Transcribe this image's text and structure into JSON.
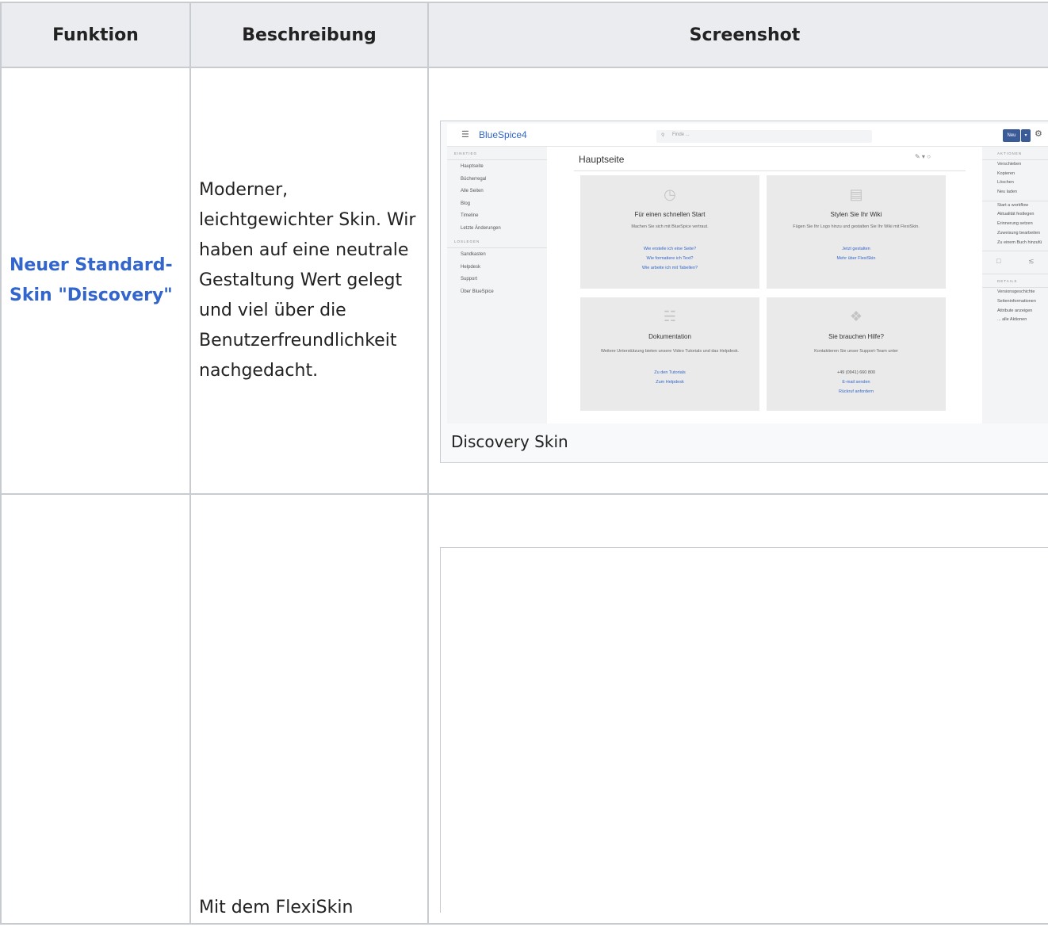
{
  "table": {
    "headers": [
      "Funktion",
      "Beschreibung",
      "Screenshot"
    ],
    "rows": [
      {
        "function": "Neuer Standard-Skin \"Discovery\"",
        "description": "Moderner, leichtgewichter Skin. Wir haben auf eine neutrale Gestaltung Wert gelegt und viel über die Benutzerfreundlichkeit nachgedacht.",
        "caption": "Discovery Skin"
      },
      {
        "function": "",
        "description": "Mit dem FlexiSkin"
      }
    ]
  },
  "shot": {
    "logo": "BlueSpice4",
    "search_placeholder": "Finde ...",
    "new_button": "Neu",
    "left_sidebar": {
      "section1": "EINSTIEG",
      "items1": [
        "Hauptseite",
        "Bücherregal",
        "Alle Seiten",
        "Blog",
        "Timeline",
        "Letzte Änderungen"
      ],
      "section2": "LOSLEGEN",
      "items2": [
        "Sandkasten",
        "Helpdesk",
        "Support",
        "Über BlueSpice"
      ]
    },
    "page_title": "Hauptseite",
    "cards": [
      {
        "title": "Für einen schnellen Start",
        "text": "Machen Sie sich mit BlueSpice vertraut.",
        "links": [
          "Wie erstelle ich eine Seite?",
          "Wie formatiere ich Text?",
          "Wie arbeite ich mit Tabellen?"
        ]
      },
      {
        "title": "Stylen Sie Ihr Wiki",
        "text": "Fügen Sie Ihr Logo hinzu und gestalten Sie Ihr Wiki mit FlexiSkin.",
        "links": [
          "Jetzt gestalten",
          "Mehr über FlexiSkin"
        ]
      },
      {
        "title": "Dokumentation",
        "text": "Weitere Unterstützung bieten unsere Video Tutorials und das Helpdesk.",
        "links": [
          "Zu den Tutorials",
          "Zum Helpdesk"
        ]
      },
      {
        "title": "Sie brauchen Hilfe?",
        "text": "Kontaktieren Sie unser Support-Team unter",
        "links": [
          "+49 (0941) 660 800",
          "E-mail senden",
          "Rückruf anfordern"
        ]
      }
    ],
    "right_sidebar": {
      "section1": "AKTIONEN",
      "items1": [
        "Verschieben",
        "Kopieren",
        "Löschen",
        "Neu laden"
      ],
      "items2": [
        "Start a workflow",
        "Aktualität festlegen",
        "Erinnerung setzen",
        "Zuweisung bearbeiten",
        "Zu einem Buch hinzufü"
      ],
      "section2": "DETAILS",
      "items3": [
        "Versionsgeschichte",
        "Seiteninformationen",
        "Attribute anzeigen",
        "... alle Aktionen"
      ]
    }
  }
}
